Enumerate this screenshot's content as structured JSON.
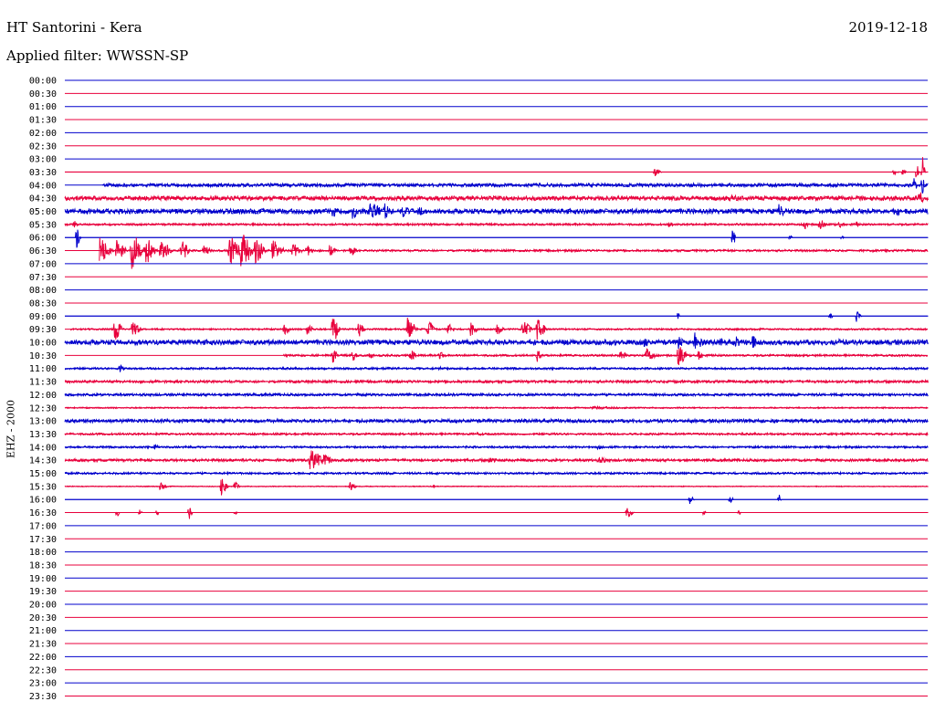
{
  "header": {
    "station": "HT Santorini - Kera",
    "date": "2019-12-18",
    "filter": "Applied filter: WWSSN-SP",
    "channel": "EHZ - 2000"
  },
  "colors": {
    "odd_trace": "#0000cc",
    "even_trace": "#e8003c"
  },
  "chart_data": {
    "type": "line",
    "title": "HT Santorini - Kera",
    "subtitle": "Applied filter: WWSSN-SP",
    "ylabel": "EHZ - 2000",
    "y_tick_labels": [
      "00:00",
      "00:30",
      "01:00",
      "01:30",
      "02:00",
      "02:30",
      "03:00",
      "03:30",
      "04:00",
      "04:30",
      "05:00",
      "05:30",
      "06:00",
      "06:30",
      "07:00",
      "07:30",
      "08:00",
      "08:30",
      "09:00",
      "09:30",
      "10:00",
      "10:30",
      "11:00",
      "11:30",
      "12:00",
      "12:30",
      "13:00",
      "13:30",
      "14:00",
      "14:30",
      "15:00",
      "15:30",
      "16:00",
      "16:30",
      "17:00",
      "17:30",
      "18:00",
      "18:30",
      "19:00",
      "19:30",
      "20:00",
      "20:30",
      "21:00",
      "21:30",
      "22:00",
      "22:30",
      "23:00",
      "23:30"
    ],
    "x_range_minutes": [
      0,
      30
    ],
    "series": [
      {
        "time": "00:00",
        "noise": 0,
        "start": 0,
        "events": []
      },
      {
        "time": "00:30",
        "noise": 0,
        "start": 0,
        "events": []
      },
      {
        "time": "01:00",
        "noise": 0,
        "start": 0,
        "events": []
      },
      {
        "time": "01:30",
        "noise": 0,
        "start": 0,
        "events": []
      },
      {
        "time": "02:00",
        "noise": 0,
        "start": 0,
        "events": []
      },
      {
        "time": "02:30",
        "noise": 0,
        "start": 0,
        "events": []
      },
      {
        "time": "03:00",
        "noise": 0,
        "start": 0,
        "events": []
      },
      {
        "time": "03:30",
        "noise": 0,
        "start": 0,
        "events": [
          [
            20.5,
            0.6,
            0.25
          ],
          [
            28.8,
            0.5,
            0.2
          ],
          [
            29.1,
            0.5,
            0.2
          ],
          [
            29.6,
            1.5,
            0.1
          ],
          [
            29.8,
            2.0,
            0.15
          ]
        ]
      },
      {
        "time": "04:00",
        "noise": 0.2,
        "start": 1.3,
        "events": [
          [
            29.5,
            1.6,
            0.12
          ],
          [
            29.8,
            1.3,
            0.1
          ]
        ]
      },
      {
        "time": "04:30",
        "noise": 0.25,
        "start": 0,
        "events": [
          [
            23.1,
            0.4,
            1.0
          ],
          [
            11.0,
            0.3,
            0.6
          ],
          [
            29.7,
            1.0,
            0.2
          ]
        ]
      },
      {
        "time": "05:00",
        "noise": 0.3,
        "start": 0,
        "events": [
          [
            9.3,
            0.8,
            0.3
          ],
          [
            10.0,
            1.0,
            0.3
          ],
          [
            10.6,
            1.3,
            0.6
          ],
          [
            11.1,
            1.0,
            0.4
          ],
          [
            11.7,
            0.9,
            0.4
          ],
          [
            12.3,
            0.7,
            0.3
          ],
          [
            24.8,
            1.0,
            0.3
          ],
          [
            28.8,
            0.6,
            0.8
          ]
        ]
      },
      {
        "time": "05:30",
        "noise": 0.12,
        "start": 0,
        "events": [
          [
            21.0,
            0.5,
            0.2
          ],
          [
            0.3,
            0.6,
            0.2
          ],
          [
            25.7,
            0.7,
            0.2
          ],
          [
            26.2,
            0.8,
            0.3
          ],
          [
            26.9,
            0.6,
            0.2
          ],
          [
            27.5,
            0.4,
            0.2
          ]
        ]
      },
      {
        "time": "06:00",
        "noise": 0,
        "start": 0,
        "events": [
          [
            0.4,
            1.4,
            0.15
          ],
          [
            23.2,
            1.2,
            0.15
          ],
          [
            25.2,
            0.3,
            0.1
          ],
          [
            27.0,
            0.3,
            0.1
          ]
        ]
      },
      {
        "time": "06:30",
        "noise": 0.12,
        "start": 1.2,
        "events": [
          [
            1.2,
            1.6,
            0.5
          ],
          [
            1.8,
            1.3,
            0.4
          ],
          [
            2.3,
            2.5,
            0.5
          ],
          [
            2.8,
            2.0,
            0.4
          ],
          [
            3.3,
            1.5,
            0.5
          ],
          [
            4.0,
            1.5,
            0.4
          ],
          [
            4.8,
            1.0,
            0.3
          ],
          [
            5.7,
            2.0,
            0.5
          ],
          [
            6.1,
            2.6,
            0.5
          ],
          [
            6.6,
            2.2,
            0.4
          ],
          [
            7.2,
            1.5,
            0.5
          ],
          [
            7.9,
            1.0,
            0.4
          ],
          [
            8.4,
            0.8,
            0.3
          ],
          [
            9.2,
            0.7,
            0.3
          ],
          [
            9.9,
            0.9,
            0.3
          ]
        ]
      },
      {
        "time": "07:00",
        "noise": 0,
        "start": 0,
        "events": []
      },
      {
        "time": "07:30",
        "noise": 0,
        "start": 0,
        "events": []
      },
      {
        "time": "08:00",
        "noise": 0,
        "start": 0,
        "events": []
      },
      {
        "time": "08:30",
        "noise": 0,
        "start": 0,
        "events": []
      },
      {
        "time": "09:00",
        "noise": 0,
        "start": 0,
        "events": [
          [
            21.3,
            0.5,
            0.1
          ],
          [
            26.6,
            0.6,
            0.1
          ],
          [
            27.5,
            0.8,
            0.2
          ]
        ]
      },
      {
        "time": "09:30",
        "noise": 0.1,
        "start": 0.2,
        "events": [
          [
            1.7,
            1.5,
            0.4
          ],
          [
            2.3,
            1.1,
            0.4
          ],
          [
            7.6,
            0.8,
            0.3
          ],
          [
            8.4,
            1.0,
            0.3
          ],
          [
            9.3,
            2.0,
            0.3
          ],
          [
            10.2,
            1.0,
            0.3
          ],
          [
            11.9,
            1.5,
            0.4
          ],
          [
            12.6,
            1.2,
            0.3
          ],
          [
            13.3,
            0.8,
            0.3
          ],
          [
            14.1,
            1.1,
            0.3
          ],
          [
            15.0,
            0.8,
            0.3
          ],
          [
            15.9,
            1.2,
            0.4
          ],
          [
            16.4,
            1.4,
            0.4
          ]
        ]
      },
      {
        "time": "10:00",
        "noise": 0.3,
        "start": 0,
        "events": [
          [
            20.1,
            0.9,
            0.3
          ],
          [
            21.3,
            1.0,
            0.3
          ],
          [
            21.9,
            1.2,
            0.4
          ],
          [
            22.7,
            0.7,
            0.3
          ],
          [
            23.3,
            0.8,
            0.3
          ],
          [
            23.9,
            0.9,
            0.3
          ],
          [
            26.9,
            0.5,
            0.2
          ]
        ]
      },
      {
        "time": "10:30",
        "noise": 0.12,
        "start": 7.6,
        "events": [
          [
            1.6,
            1.2,
            0.6
          ],
          [
            1.1,
            0.7,
            0.2
          ],
          [
            9.3,
            1.1,
            0.2
          ],
          [
            10.0,
            0.8,
            0.2
          ],
          [
            10.6,
            0.6,
            0.2
          ],
          [
            12.0,
            0.8,
            0.3
          ],
          [
            13.0,
            0.8,
            0.2
          ],
          [
            16.4,
            1.0,
            0.2
          ],
          [
            19.3,
            0.8,
            0.3
          ],
          [
            20.2,
            1.0,
            0.4
          ],
          [
            21.3,
            1.4,
            0.4
          ],
          [
            22.0,
            0.7,
            0.3
          ]
        ]
      },
      {
        "time": "11:00",
        "noise": 0.12,
        "start": 0,
        "events": [
          [
            1.9,
            0.6,
            0.2
          ],
          [
            13.0,
            0.4,
            0.1
          ]
        ]
      },
      {
        "time": "11:30",
        "noise": 0.15,
        "start": 0,
        "events": [
          [
            21.2,
            0.5,
            0.2
          ]
        ]
      },
      {
        "time": "12:00",
        "noise": 0.15,
        "start": 0,
        "events": []
      },
      {
        "time": "12:30",
        "noise": 0.08,
        "start": 0,
        "events": [
          [
            18.3,
            0.2,
            2.0
          ]
        ]
      },
      {
        "time": "13:00",
        "noise": 0.2,
        "start": 0,
        "events": []
      },
      {
        "time": "13:30",
        "noise": 0.12,
        "start": 0,
        "events": [
          [
            14.3,
            0.2,
            0.8
          ]
        ]
      },
      {
        "time": "14:00",
        "noise": 0.12,
        "start": 0,
        "events": [
          [
            3.1,
            0.3,
            0.3
          ],
          [
            18.5,
            0.3,
            0.5
          ]
        ]
      },
      {
        "time": "14:30",
        "noise": 0.15,
        "start": 0,
        "events": [
          [
            8.5,
            1.3,
            1.0
          ],
          [
            14.7,
            0.4,
            0.6
          ],
          [
            18.5,
            0.4,
            0.7
          ]
        ]
      },
      {
        "time": "15:00",
        "noise": 0.12,
        "start": 0,
        "events": []
      },
      {
        "time": "15:30",
        "noise": 0.05,
        "start": 0,
        "events": [
          [
            3.3,
            0.5,
            0.3
          ],
          [
            5.4,
            1.3,
            0.3
          ],
          [
            5.9,
            0.6,
            0.2
          ],
          [
            9.9,
            0.6,
            0.3
          ],
          [
            12.8,
            0.3,
            0.1
          ]
        ]
      },
      {
        "time": "16:00",
        "noise": 0,
        "start": 0,
        "events": [
          [
            21.7,
            0.6,
            0.2
          ],
          [
            23.1,
            0.6,
            0.15
          ],
          [
            24.8,
            0.8,
            0.1
          ]
        ]
      },
      {
        "time": "16:30",
        "noise": 0,
        "start": 0,
        "events": [
          [
            1.8,
            0.9,
            0.1
          ],
          [
            2.6,
            0.4,
            0.1
          ],
          [
            3.2,
            0.5,
            0.1
          ],
          [
            4.3,
            1.0,
            0.15
          ],
          [
            5.9,
            0.5,
            0.1
          ],
          [
            19.5,
            0.7,
            0.3
          ],
          [
            22.2,
            0.5,
            0.1
          ],
          [
            23.4,
            0.6,
            0.1
          ]
        ]
      },
      {
        "time": "17:00",
        "noise": 0,
        "start": 0,
        "events": []
      },
      {
        "time": "17:30",
        "noise": 0,
        "start": 0,
        "events": []
      },
      {
        "time": "18:00",
        "noise": 0,
        "start": 0,
        "events": []
      },
      {
        "time": "18:30",
        "noise": 0,
        "start": 0,
        "events": []
      },
      {
        "time": "19:00",
        "noise": 0,
        "start": 0,
        "events": []
      },
      {
        "time": "19:30",
        "noise": 0,
        "start": 0,
        "events": []
      },
      {
        "time": "20:00",
        "noise": 0,
        "start": 0,
        "events": []
      },
      {
        "time": "20:30",
        "noise": 0,
        "start": 0,
        "events": []
      },
      {
        "time": "21:00",
        "noise": 0,
        "start": 0,
        "events": []
      },
      {
        "time": "21:30",
        "noise": 0,
        "start": 0,
        "events": []
      },
      {
        "time": "22:00",
        "noise": 0,
        "start": 0,
        "events": []
      },
      {
        "time": "22:30",
        "noise": 0,
        "start": 0,
        "events": []
      },
      {
        "time": "23:00",
        "noise": 0,
        "start": 0,
        "events": []
      },
      {
        "time": "23:30",
        "noise": 0,
        "start": 0,
        "events": []
      }
    ]
  }
}
